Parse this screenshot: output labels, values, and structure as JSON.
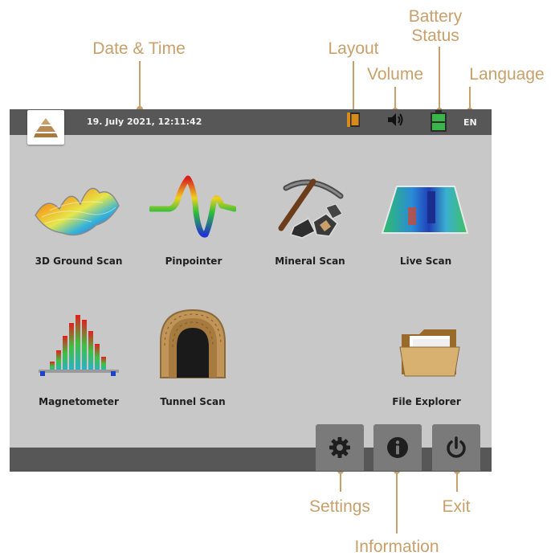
{
  "callouts": {
    "date_time": "Date & Time",
    "layout": "Layout",
    "volume": "Volume",
    "battery_status_line1": "Battery",
    "battery_status_line2": "Status",
    "language": "Language",
    "settings": "Settings",
    "information": "Information",
    "exit": "Exit"
  },
  "status_bar": {
    "datetime": "19. July 2021, 12:11:42",
    "language": "EN"
  },
  "apps": {
    "ground_scan": "3D Ground Scan",
    "pinpointer": "Pinpointer",
    "mineral_scan": "Mineral Scan",
    "live_scan": "Live Scan",
    "magnetometer": "Magnetometer",
    "tunnel_scan": "Tunnel Scan",
    "file_explorer": "File Explorer"
  },
  "colors": {
    "callout": "#c8a06b",
    "bar": "#575757",
    "panel": "#c8c8c8",
    "button": "#7a7a7a",
    "battery": "#3bb54a",
    "layout_icon": "#d98b1a"
  },
  "icons": {
    "logo": "pyramid-logo-icon",
    "layout": "layout-icon",
    "volume": "speaker-icon",
    "battery": "battery-icon",
    "settings": "gear-icon",
    "information": "info-icon",
    "exit": "power-icon"
  }
}
